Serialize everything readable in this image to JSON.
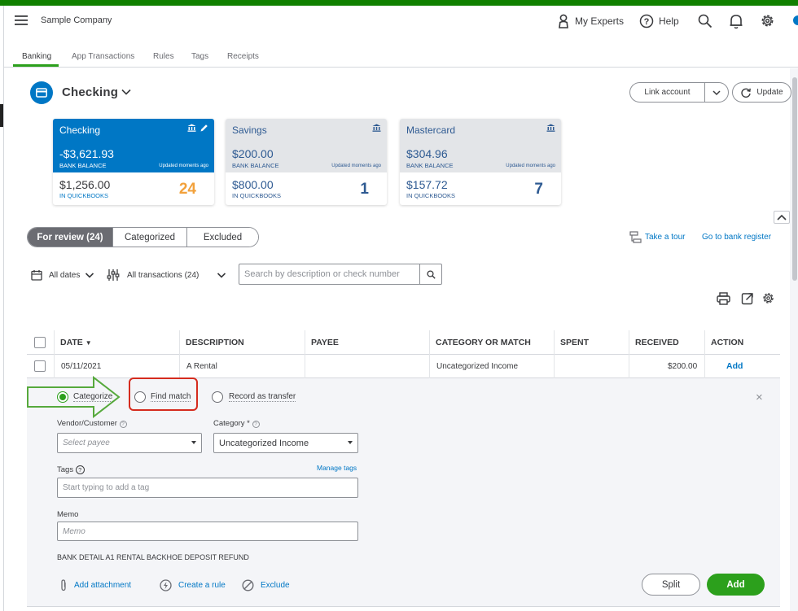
{
  "header": {
    "company": "Sample Company",
    "my_experts": "My Experts",
    "help": "Help"
  },
  "subnav": {
    "tabs": [
      "Banking",
      "App Transactions",
      "Rules",
      "Tags",
      "Receipts"
    ],
    "active": "Banking"
  },
  "account": {
    "title": "Checking",
    "link_account": "Link account",
    "update": "Update"
  },
  "cards": [
    {
      "name": "Checking",
      "bank_balance": "-$3,621.93",
      "bank_balance_label": "BANK BALANCE",
      "updated": "Updated moments ago",
      "qb_balance": "$1,256.00",
      "qb_label": "IN QUICKBOOKS",
      "count": "24",
      "selected": true
    },
    {
      "name": "Savings",
      "bank_balance": "$200.00",
      "bank_balance_label": "BANK BALANCE",
      "updated": "Updated moments ago",
      "qb_balance": "$800.00",
      "qb_label": "IN QUICKBOOKS",
      "count": "1",
      "selected": false
    },
    {
      "name": "Mastercard",
      "bank_balance": "$304.96",
      "bank_balance_label": "BANK BALANCE",
      "updated": "Updated moments ago",
      "qb_balance": "$157.72",
      "qb_label": "IN QUICKBOOKS",
      "count": "7",
      "selected": false
    }
  ],
  "review_tabs": [
    "For review (24)",
    "Categorized",
    "Excluded"
  ],
  "links": {
    "take_tour": "Take a tour",
    "bank_register": "Go to bank register"
  },
  "filters": {
    "dates": "All dates",
    "transactions": "All transactions (24)",
    "search_placeholder": "Search by description or check number"
  },
  "table": {
    "headers": [
      "DATE",
      "DESCRIPTION",
      "PAYEE",
      "CATEGORY OR MATCH",
      "SPENT",
      "RECEIVED",
      "ACTION"
    ],
    "row": {
      "date": "05/11/2021",
      "description": "A Rental",
      "payee": "",
      "category": "Uncategorized Income",
      "spent": "",
      "received": "$200.00",
      "action": "Add"
    }
  },
  "detail": {
    "radios": [
      "Categorize",
      "Find match",
      "Record as transfer"
    ],
    "selected_radio": "Categorize",
    "vendor_label": "Vendor/Customer",
    "vendor_placeholder": "Select payee",
    "category_label": "Category *",
    "category_value": "Uncategorized Income",
    "tags_label": "Tags",
    "manage_tags": "Manage tags",
    "tags_placeholder": "Start typing to add a tag",
    "memo_label": "Memo",
    "memo_placeholder": "Memo",
    "bank_detail_label": "BANK DETAIL",
    "bank_detail_value": "A1 RENTAL BACKHOE DEPOSIT REFUND",
    "add_attachment": "Add attachment",
    "create_rule": "Create a rule",
    "exclude": "Exclude",
    "split": "Split",
    "add": "Add",
    "close": "×"
  },
  "colors": {
    "brand_green": "#2ca01c",
    "top_strip": "#108000",
    "link_blue": "#0077c5",
    "card_selected": "#0077c5",
    "card_unselected": "#e3e5e8",
    "annotation_red": "#d52b1e",
    "annotation_arrow": "#56a93c"
  },
  "icons": [
    "menu-icon",
    "person-icon",
    "help-icon",
    "search-icon",
    "bell-icon",
    "gear-icon",
    "bank-icon",
    "pencil-icon",
    "chevron-down-icon",
    "refresh-icon",
    "calendar-icon",
    "filter-icon",
    "print-icon",
    "export-icon",
    "tour-icon",
    "paperclip-icon",
    "bolt-icon",
    "ban-icon",
    "close-icon",
    "chevron-up-icon"
  ]
}
